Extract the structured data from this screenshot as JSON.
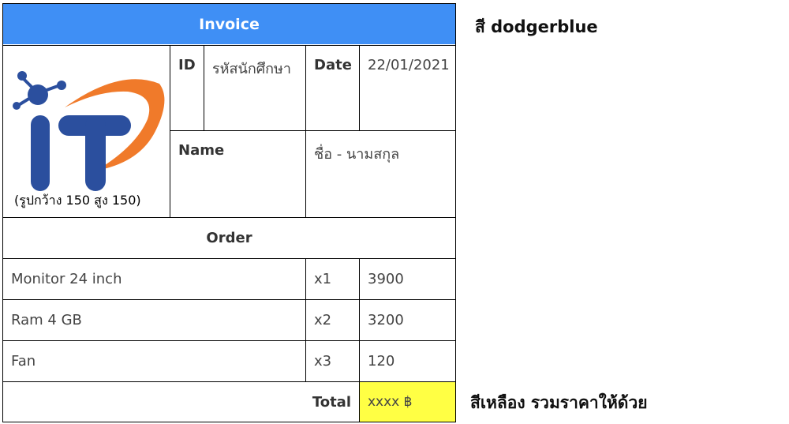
{
  "header": {
    "title": "Invoice",
    "color": "#3f8ff5"
  },
  "logo": {
    "icon": "it-logo-icon",
    "caption": "(รูปกว้าง 150 สูง 150)"
  },
  "info": {
    "id_label": "ID",
    "id_value": "รหัสนักศึกษา",
    "date_label": "Date",
    "date_value": "22/01/2021",
    "name_label": "Name",
    "name_value": "ชื่อ - นามสกุล"
  },
  "order": {
    "title": "Order",
    "items": [
      {
        "name": "Monitor 24 inch",
        "qty": "x1",
        "price": "3900"
      },
      {
        "name": "Ram 4 GB",
        "qty": "x2",
        "price": "3200"
      },
      {
        "name": "Fan",
        "qty": "x3",
        "price": "120"
      }
    ],
    "total_label": "Total",
    "total_value": "xxxx ฿",
    "total_color": "#ffff44"
  },
  "notes": {
    "header_note": "สี dodgerblue",
    "total_note": "สีเหลือง รวมราคาให้ด้วย"
  }
}
